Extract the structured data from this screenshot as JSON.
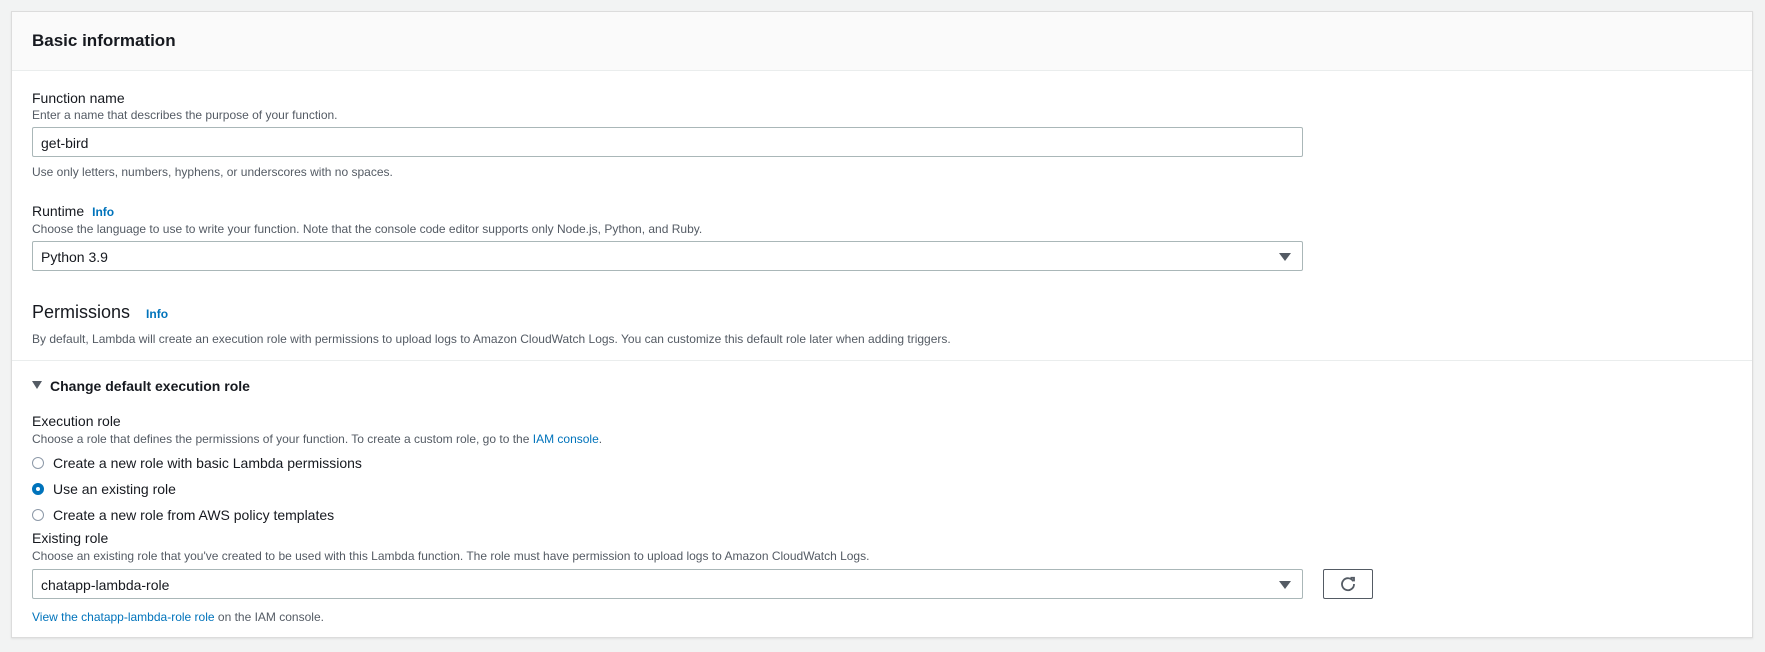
{
  "basic_info": {
    "title": "Basic information"
  },
  "function_name": {
    "label": "Function name",
    "description": "Enter a name that describes the purpose of your function.",
    "value": "get-bird",
    "hint": "Use only letters, numbers, hyphens, or underscores with no spaces."
  },
  "runtime": {
    "label": "Runtime",
    "info": "Info",
    "description": "Choose the language to use to write your function. Note that the console code editor supports only Node.js, Python, and Ruby.",
    "selected": "Python 3.9"
  },
  "permissions": {
    "title": "Permissions",
    "info": "Info",
    "description": "By default, Lambda will create an execution role with permissions to upload logs to Amazon CloudWatch Logs. You can customize this default role later when adding triggers."
  },
  "execution_role_section": {
    "expander_label": "Change default execution role",
    "label": "Execution role",
    "description_prefix": "Choose a role that defines the permissions of your function. To create a custom role, go to the ",
    "iam_console_link": "IAM console",
    "description_suffix": ".",
    "options": [
      {
        "label": "Create a new role with basic Lambda permissions",
        "checked": false
      },
      {
        "label": "Use an existing role",
        "checked": true
      },
      {
        "label": "Create a new role from AWS policy templates",
        "checked": false
      }
    ]
  },
  "existing_role": {
    "label": "Existing role",
    "description": "Choose an existing role that you've created to be used with this Lambda function. The role must have permission to upload logs to Amazon CloudWatch Logs.",
    "selected": "chatapp-lambda-role",
    "view_link": "View the chatapp-lambda-role role",
    "view_suffix": " on the IAM console."
  },
  "icons": {
    "refresh": "refresh-icon",
    "dropdown": "caret-down-icon",
    "expander": "triangle-down-icon"
  },
  "colors": {
    "link": "#0073bb",
    "radio_checked": "#0073bb",
    "header_bg": "#fafafa"
  }
}
